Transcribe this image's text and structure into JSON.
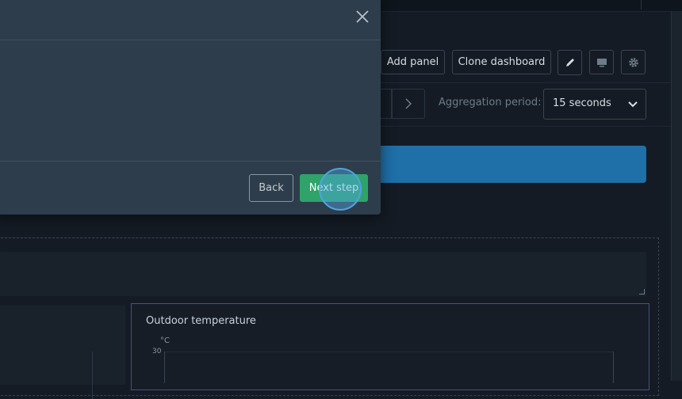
{
  "toolbar": {
    "add_panel_label": "Add panel",
    "clone_dashboard_label": "Clone dashboard",
    "edit_icon": "pencil-icon",
    "display_icon": "monitor-icon",
    "settings_icon": "gear-icon"
  },
  "time_controls": {
    "aggregation_label": "Aggregation period:",
    "aggregation_value": "15 seconds"
  },
  "chart_panel": {
    "title": "Outdoor temperature",
    "unit": "°C",
    "y_tick_top": "30"
  },
  "modal": {
    "back_label": "Back",
    "next_label": "Next step",
    "close_icon": "close-icon"
  },
  "colors": {
    "accent_blue": "#1f6fa8",
    "next_green": "#2fa36a",
    "modal_bg": "#2d3d4b",
    "page_bg": "#141b24"
  }
}
